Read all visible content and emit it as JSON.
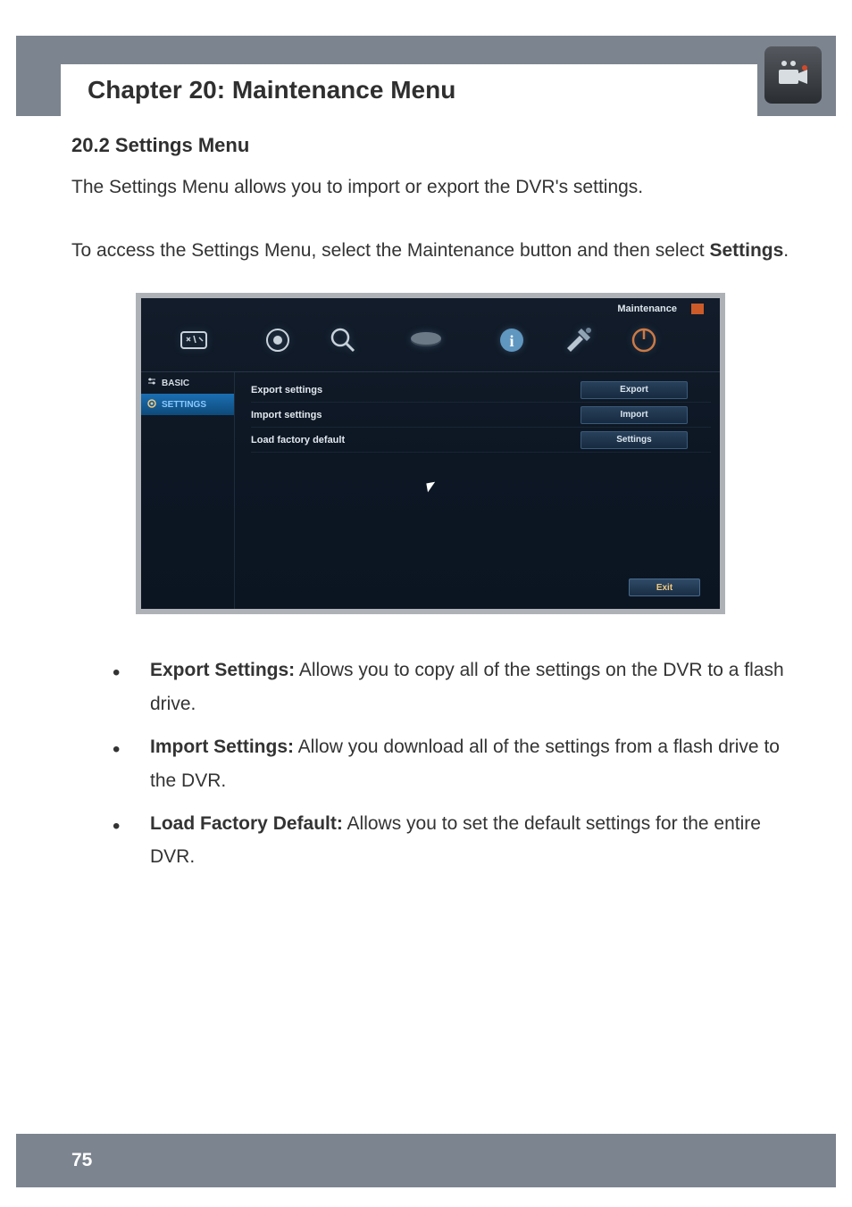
{
  "header": {
    "chapter_title": "Chapter 20: Maintenance Menu",
    "icon_name": "camera-icon"
  },
  "section": {
    "heading": "20.2 Settings Menu",
    "para1": "The Settings Menu allows you to import or export the DVR's settings.",
    "para2_pre": "To access the Settings Menu, select the Maintenance button and then select ",
    "para2_bold": "Settings",
    "para2_post": "."
  },
  "screenshot": {
    "window_title": "Maintenance",
    "top_icons": [
      "system-tools-icon",
      "record-icon",
      "search-icon",
      "disk-icon",
      "info-icon",
      "maintenance-icon",
      "power-icon"
    ],
    "sidebar": {
      "items": [
        {
          "icon": "sliders-icon",
          "label": "BASIC",
          "selected": false
        },
        {
          "icon": "gear-icon",
          "label": "SETTINGS",
          "selected": true
        }
      ]
    },
    "rows": [
      {
        "label": "Export settings",
        "button": "Export"
      },
      {
        "label": "Import settings",
        "button": "Import"
      },
      {
        "label": "Load factory default",
        "button": "Settings"
      }
    ],
    "exit_button": "Exit"
  },
  "bullets": [
    {
      "term": "Export Settings:",
      "desc": " Allows you to copy all of the settings on the DVR to a flash drive."
    },
    {
      "term": "Import Settings:",
      "desc": " Allow you download all of the settings from a flash drive to the DVR."
    },
    {
      "term": "Load Factory Default:",
      "desc": " Allows you to set the default settings for the entire DVR."
    }
  ],
  "footer": {
    "page_number": "75"
  }
}
